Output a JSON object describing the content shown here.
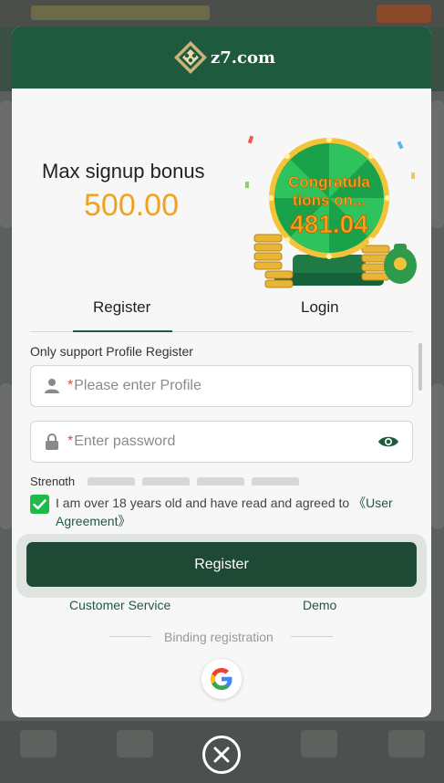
{
  "header": {
    "site_name": "z7.com"
  },
  "promo": {
    "title": "Max signup bonus",
    "amount": "500.00",
    "wheel_text_line1": "Congratula",
    "wheel_text_line2": "tions on...",
    "wheel_amount": "481.04"
  },
  "tabs": [
    {
      "label": "Register",
      "active": true
    },
    {
      "label": "Login",
      "active": false
    }
  ],
  "form": {
    "hint": "Only support Profile Register",
    "required_mark": "*",
    "profile_placeholder": "Please enter Profile",
    "password_placeholder": "Enter password",
    "strength_label": "Strength",
    "agree_text": "I am over 18 years old and have read and agreed to ",
    "agree_link": "《User Agreement》",
    "agree_checked": true,
    "submit_label": "Register"
  },
  "links": {
    "customer_service": "Customer Service",
    "demo": "Demo"
  },
  "binding": {
    "label": "Binding registration"
  },
  "icons": {
    "profile": "user-icon",
    "password": "lock-icon",
    "visibility": "eye-icon",
    "google": "google-icon",
    "close": "close-icon",
    "check": "check-icon"
  },
  "colors": {
    "brand_green": "#1e5a3d",
    "amount_orange": "#f0a321",
    "checkbox_green": "#1fbb4a",
    "required_red": "#e24a3b"
  }
}
